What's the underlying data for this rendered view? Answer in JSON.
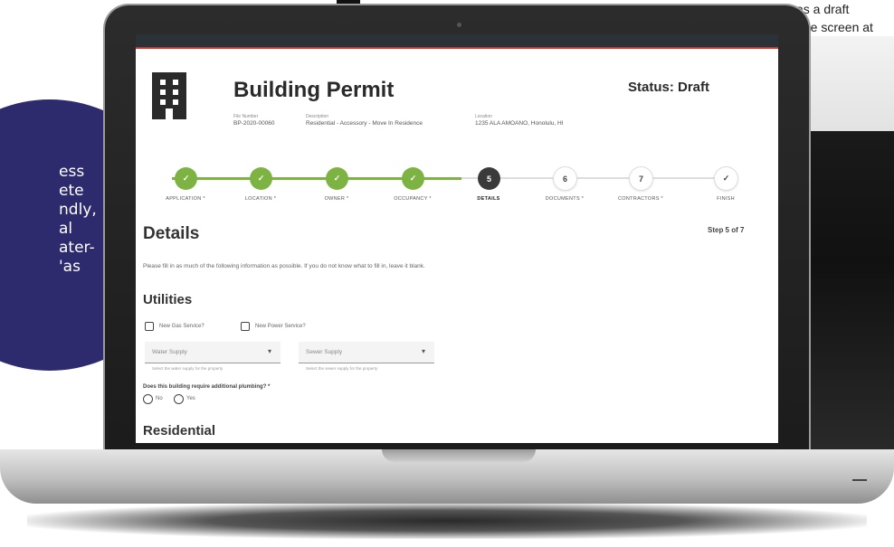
{
  "promo": {
    "lines": [
      "ess",
      "ete",
      "ndly,",
      "al",
      "ater-",
      "'as"
    ]
  },
  "caption": {
    "line1": "as a draft",
    "line2": "me screen at"
  },
  "permit": {
    "title": "Building Permit",
    "status": "Status: Draft",
    "meta": [
      {
        "label": "File Number",
        "value": "BP-2020-00060"
      },
      {
        "label": "Description",
        "value": "Residential - Accessory - Move In Residence"
      },
      {
        "label": "Location",
        "value": "1235 ALA AMOANO, Honolulu, HI"
      }
    ]
  },
  "stepper": {
    "steps": [
      {
        "label": "APPLICATION *",
        "state": "done",
        "glyph": "✓"
      },
      {
        "label": "LOCATION *",
        "state": "done",
        "glyph": "✓"
      },
      {
        "label": "OWNER *",
        "state": "done",
        "glyph": "✓"
      },
      {
        "label": "OCCUPANCY *",
        "state": "done",
        "glyph": "✓"
      },
      {
        "label": "DETAILS",
        "state": "current",
        "glyph": "5"
      },
      {
        "label": "DOCUMENTS *",
        "state": "todo",
        "glyph": "6"
      },
      {
        "label": "CONTRACTORS *",
        "state": "todo",
        "glyph": "7"
      },
      {
        "label": "FINISH",
        "state": "todo",
        "glyph": "✓"
      }
    ]
  },
  "details": {
    "heading": "Details",
    "step_of": "Step 5 of 7",
    "instructions": "Please fill in as much of the following information as possible. If you do not know what to fill in, leave it blank."
  },
  "utilities": {
    "heading": "Utilities",
    "gas_label": "New Gas Service?",
    "power_label": "New Power Service?",
    "water_select": "Water Supply",
    "water_help": "Select the water supply for the property",
    "sewer_select": "Sewer Supply",
    "sewer_help": "Select the sewer supply for the property",
    "plumbing_question": "Does this building require additional plumbing? *",
    "radio_no": "No",
    "radio_yes": "Yes"
  },
  "residential": {
    "heading": "Residential"
  },
  "icons": {
    "building": "building-icon",
    "check": "check-icon",
    "dropdown": "chevron-down-icon"
  },
  "colors": {
    "accent_green": "#7cb342",
    "current_step": "#3a3a3a",
    "promo_purple": "#2d2a6e",
    "topbar_red": "#c0392b"
  }
}
